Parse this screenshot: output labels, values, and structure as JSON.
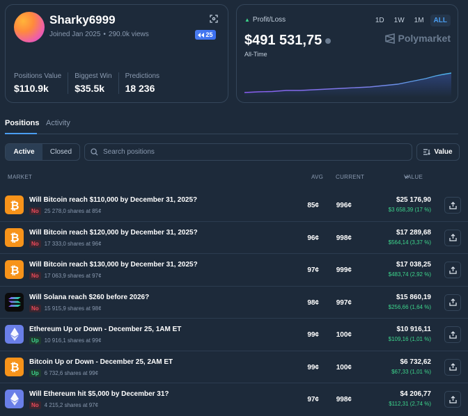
{
  "profile": {
    "username": "Sharky6999",
    "joined": "Joined Jan 2025",
    "separator": "•",
    "views": "290.0k views",
    "badge": "25",
    "stats": [
      {
        "label": "Positions Value",
        "value": "$110.9k"
      },
      {
        "label": "Biggest Win",
        "value": "$35.5k"
      },
      {
        "label": "Predictions",
        "value": "18 236"
      }
    ]
  },
  "pnl": {
    "label": "Profit/Loss",
    "value": "$491 531,75",
    "period": "All-Time",
    "ranges": [
      "1D",
      "1W",
      "1M",
      "ALL"
    ],
    "active_range": "ALL",
    "brand": "Polymarket",
    "colors": {
      "up": "#3dd68c",
      "line": "#7b7fe8",
      "accent": "#4a9df0"
    }
  },
  "tabs": [
    "Positions",
    "Activity"
  ],
  "filters": {
    "active": "Active",
    "closed": "Closed"
  },
  "search": {
    "placeholder": "Search positions"
  },
  "sort": {
    "label": "Value"
  },
  "columns": {
    "market": "MARKET",
    "avg": "AVG",
    "current": "CURRENT",
    "value": "VALUE"
  },
  "positions": [
    {
      "icon": "bitcoin-icon",
      "title": "Will Bitcoin reach $110,000 by December 31, 2025?",
      "outcome": "No",
      "shares": "25 278,0 shares at 85¢",
      "avg": "85¢",
      "current": "996¢",
      "value": "$25 176,90",
      "pnl": "$3 658,39 (17 %)"
    },
    {
      "icon": "bitcoin-icon",
      "title": "Will Bitcoin reach $120,000 by December 31, 2025?",
      "outcome": "No",
      "shares": "17 333,0 shares at 96¢",
      "avg": "96¢",
      "current": "998¢",
      "value": "$17 289,68",
      "pnl": "$564,14 (3,37 %)"
    },
    {
      "icon": "bitcoin-icon",
      "title": "Will Bitcoin reach $130,000 by December 31, 2025?",
      "outcome": "No",
      "shares": "17 063,9 shares at 97¢",
      "avg": "97¢",
      "current": "999¢",
      "value": "$17 038,25",
      "pnl": "$483,74 (2,92 %)"
    },
    {
      "icon": "solana-icon",
      "title": "Will Solana reach $260 before 2026?",
      "outcome": "No",
      "shares": "15 915,9 shares at 98¢",
      "avg": "98¢",
      "current": "997¢",
      "value": "$15 860,19",
      "pnl": "$256,66 (1,64 %)"
    },
    {
      "icon": "ethereum-icon",
      "title": "Ethereum Up or Down - December 25, 1AM ET",
      "outcome": "Up",
      "shares": "10 916,1 shares at 99¢",
      "avg": "99¢",
      "current": "100¢",
      "value": "$10 916,11",
      "pnl": "$109,16 (1,01 %)"
    },
    {
      "icon": "bitcoin-icon",
      "title": "Bitcoin Up or Down - December 25, 2AM ET",
      "outcome": "Up",
      "shares": "6 732,6 shares at 99¢",
      "avg": "99¢",
      "current": "100¢",
      "value": "$6 732,62",
      "pnl": "$67,33 (1,01 %)"
    },
    {
      "icon": "ethereum-icon",
      "title": "Will Ethereum hit $5,000 by December 31?",
      "outcome": "No",
      "shares": "4 215,2 shares at 97¢",
      "avg": "97¢",
      "current": "998¢",
      "value": "$4 206,77",
      "pnl": "$112,31 (2,74 %)"
    }
  ]
}
